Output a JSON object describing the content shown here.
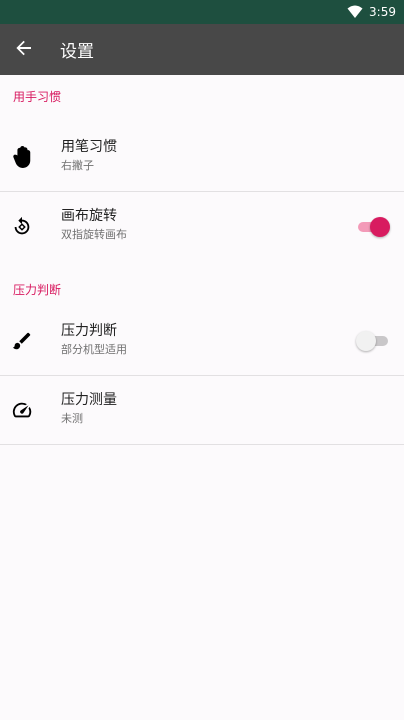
{
  "status_bar": {
    "time": "3:59",
    "wifi_icon": "wifi-icon"
  },
  "app_bar": {
    "title": "设置",
    "back_icon": "arrow-back-icon"
  },
  "colors": {
    "accent": "#d81b60",
    "app_bar": "#484848",
    "status_bar": "#1e4f3f"
  },
  "sections": [
    {
      "header": "用手习惯",
      "items": [
        {
          "title": "用笔习惯",
          "subtitle": "右撇子",
          "icon": "hand-icon"
        },
        {
          "title": "画布旋转",
          "subtitle": "双指旋转画布",
          "icon": "rotate-icon",
          "switch": true
        }
      ]
    },
    {
      "header": "压力判断",
      "items": [
        {
          "title": "压力判断",
          "subtitle": "部分机型适用",
          "icon": "brush-icon",
          "switch": false
        },
        {
          "title": "压力测量",
          "subtitle": "未测",
          "icon": "speedometer-icon"
        }
      ]
    }
  ]
}
